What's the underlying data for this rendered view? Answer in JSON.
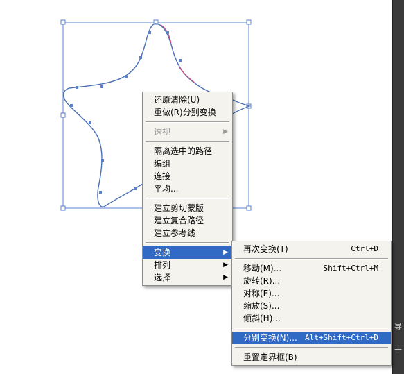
{
  "context_menu": {
    "items": [
      {
        "label": "还原清除(U)",
        "enabled": true
      },
      {
        "label": "重做(R)分别变换",
        "enabled": true
      },
      {
        "label": "透视",
        "enabled": false,
        "submenu": true
      },
      {
        "label": "隔离选中的路径",
        "enabled": true
      },
      {
        "label": "编组",
        "enabled": true
      },
      {
        "label": "连接",
        "enabled": true
      },
      {
        "label": "平均...",
        "enabled": true
      },
      {
        "label": "建立剪切蒙版",
        "enabled": true
      },
      {
        "label": "建立复合路径",
        "enabled": true
      },
      {
        "label": "建立参考线",
        "enabled": true
      },
      {
        "label": "变换",
        "enabled": true,
        "submenu": true,
        "highlighted": true
      },
      {
        "label": "排列",
        "enabled": true,
        "submenu": true
      },
      {
        "label": "选择",
        "enabled": true,
        "submenu": true
      }
    ],
    "submenu_arrow": "▶"
  },
  "transform_submenu": {
    "items": [
      {
        "label": "再次变换(T)",
        "shortcut": "Ctrl+D"
      },
      {
        "label": "移动(M)...",
        "shortcut": "Shift+Ctrl+M"
      },
      {
        "label": "旋转(R)...",
        "shortcut": ""
      },
      {
        "label": "对称(E)...",
        "shortcut": ""
      },
      {
        "label": "缩放(S)...",
        "shortcut": ""
      },
      {
        "label": "倾斜(H)...",
        "shortcut": ""
      },
      {
        "label": "分别变换(N)...",
        "shortcut": "Alt+Shift+Ctrl+D",
        "highlighted": true
      },
      {
        "label": "重置定界框(B)",
        "shortcut": ""
      }
    ]
  },
  "side_panel": {
    "label_top": "导",
    "label_bottom": "十"
  },
  "colors": {
    "menu_bg": "#f4f3ee",
    "highlight": "#316ac5",
    "path_stroke": "#4a6fb5",
    "path_accent": "#d04a7a",
    "anchor": "#5a80d0",
    "bounding_box": "#5a80d0"
  }
}
